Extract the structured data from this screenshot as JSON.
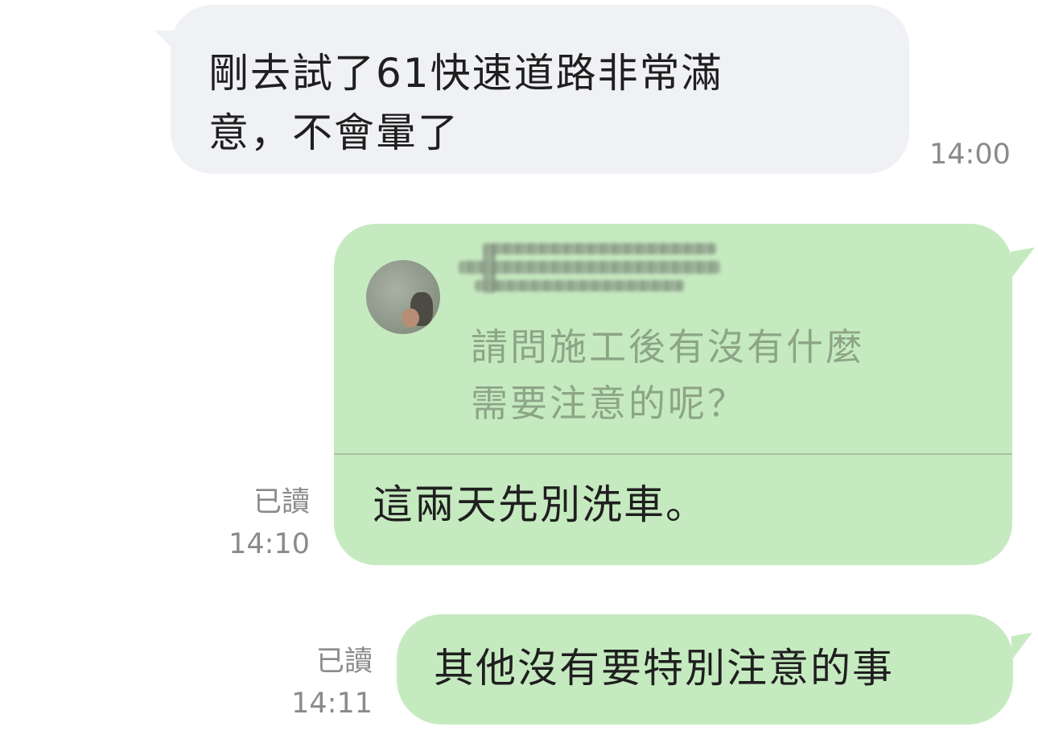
{
  "messages": {
    "incoming": {
      "text_line1": "剛去試了61快速道路非常滿",
      "text_line2": "意，不會暈了",
      "time": "14:00"
    },
    "outgoing_reply": {
      "quote": {
        "text_line1": "請問施工後有沒有什麼",
        "text_line2": "需要注意的呢？"
      },
      "text": "這兩天先別洗車。",
      "read_label": "已讀",
      "time": "14:10"
    },
    "outgoing_second": {
      "text": "其他沒有要特別注意的事",
      "read_label": "已讀",
      "time": "14:11"
    }
  },
  "colors": {
    "incoming_bubble": "#f0f1f5",
    "outgoing_bubble": "#c6eac0",
    "quote_text": "#8da587",
    "meta_text": "#8a8a8a"
  }
}
